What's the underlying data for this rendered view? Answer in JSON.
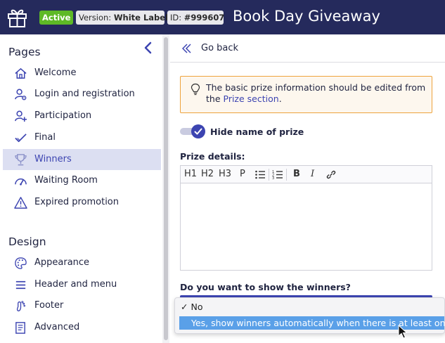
{
  "header": {
    "status_badge": "Active",
    "version_label": "Version:",
    "version_value": "White Label",
    "id_label": "ID:",
    "id_value": "#999607",
    "title": "Book Day Giveaway"
  },
  "sidebar": {
    "pages_title": "Pages",
    "pages": [
      {
        "label": "Welcome",
        "icon": "home-icon"
      },
      {
        "label": "Login and registration",
        "icon": "user-settings-icon"
      },
      {
        "label": "Participation",
        "icon": "user-add-icon"
      },
      {
        "label": "Final",
        "icon": "check-icon"
      },
      {
        "label": "Winners",
        "icon": "trophy-icon",
        "active": true
      },
      {
        "label": "Waiting Room",
        "icon": "gauge-icon"
      },
      {
        "label": "Expired promotion",
        "icon": "warning-icon"
      }
    ],
    "design_title": "Design",
    "design": [
      {
        "label": "Appearance",
        "icon": "palette-icon"
      },
      {
        "label": "Header and menu",
        "icon": "menu-icon"
      },
      {
        "label": "Footer",
        "icon": "footprint-icon"
      },
      {
        "label": "Advanced",
        "icon": "document-icon"
      }
    ]
  },
  "main": {
    "go_back": "Go back",
    "info_text_before": "The basic prize information should be edited from the ",
    "info_link": "Prize section",
    "info_text_after": ".",
    "hide_name_label": "Hide name of prize",
    "hide_name_enabled": true,
    "prize_details_label": "Prize details:",
    "toolbar": {
      "h1": "H1",
      "h2": "H2",
      "h3": "H3",
      "p": "P",
      "bold": "B",
      "italic": "I"
    },
    "winners_question": "Do you want to show the winners?"
  },
  "dropdown": {
    "options": [
      {
        "label": "No",
        "checked": true
      },
      {
        "label": "Yes, show winners automatically when there is at least one",
        "highlighted": true
      }
    ],
    "check_mark": "✓"
  },
  "colors": {
    "header_bg": "#252a5c",
    "accent": "#3c44b1",
    "active_badge": "#5eb926",
    "warning_border": "#eea33c",
    "highlight": "#5aa0e8"
  }
}
